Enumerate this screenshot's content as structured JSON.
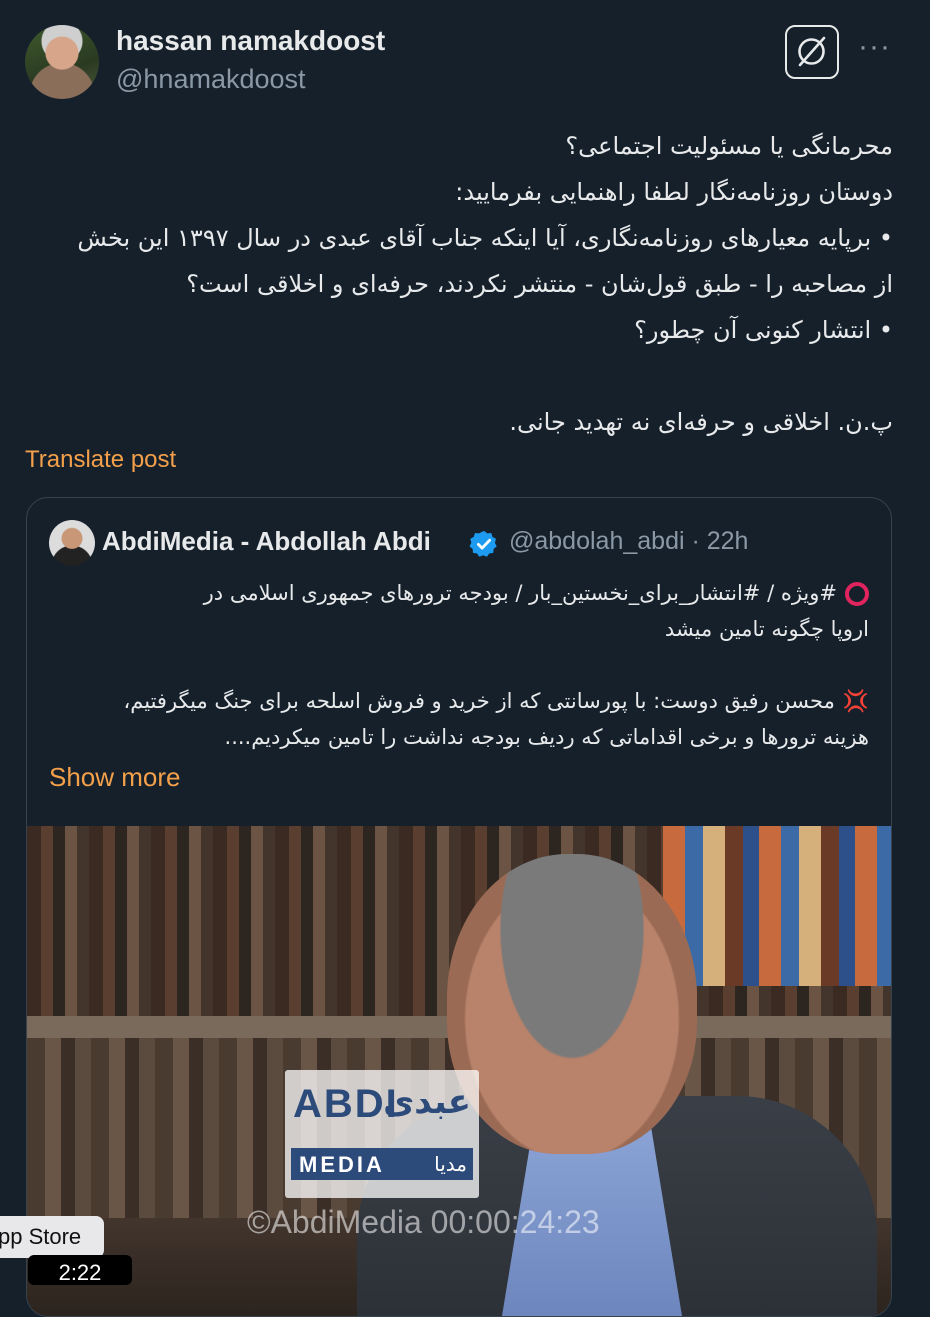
{
  "author": {
    "display_name": "hassan namakdoost",
    "handle": "@hnamakdoost"
  },
  "post": {
    "lines": [
      "محرمانگی یا مسئولیت اجتماعی؟",
      "دوستان روزنامه‌نگار لطفا راهنمایی بفرمایید:",
      "• برپایه معیارهای روزنامه‌نگاری، آیا اینکه جناب آقای عبدی در سال ۱۳۹۷ این بخش",
      "از مصاحبه را - طبق قول‌شان - منتشر نکردند،  حرفه‌ای و اخلاقی است؟",
      "• انتشار کنونی آن چطور؟",
      "",
      "پ.ن. اخلاقی و حرفه‌ای نه تهدید جانی."
    ],
    "translate_label": "Translate post"
  },
  "quote": {
    "display_name": "AbdiMedia - Abdollah Abdi",
    "handle_time": "@abdolah_abdi · 22h",
    "line1": "#ویژه / #انتشار_برای_نخستین_بار / بودجه ترورهای جمهوری اسلامی در",
    "line2": "اروپا چگونه تامین میشد",
    "line3": "محسن رفیق دوست: با پورسانتی که از خرید و فروش اسلحه برای جنگ میگرفتیم،",
    "line4": "هزینه ترورها و برخی اقداماتی که ردیف بودجه نداشت را تامین میکردیم....",
    "show_more": "Show more",
    "emoji1": "red-circle-icon",
    "emoji2": "anger-symbol-icon"
  },
  "video": {
    "logo_latin": "ABDI",
    "logo_persian": "عبدی",
    "logo_media_latin": "MEDIA",
    "logo_media_persian": "مدیا",
    "watermark": "©AbdiMedia 00:00:24:23"
  },
  "overlay": {
    "appstore_tooltip": "pp Store",
    "time_chip": "2:22"
  },
  "colors": {
    "background": "#15202b",
    "accent": "#f4a04a",
    "verified": "#1d9bf0",
    "secondary_text": "#8b98a5"
  }
}
